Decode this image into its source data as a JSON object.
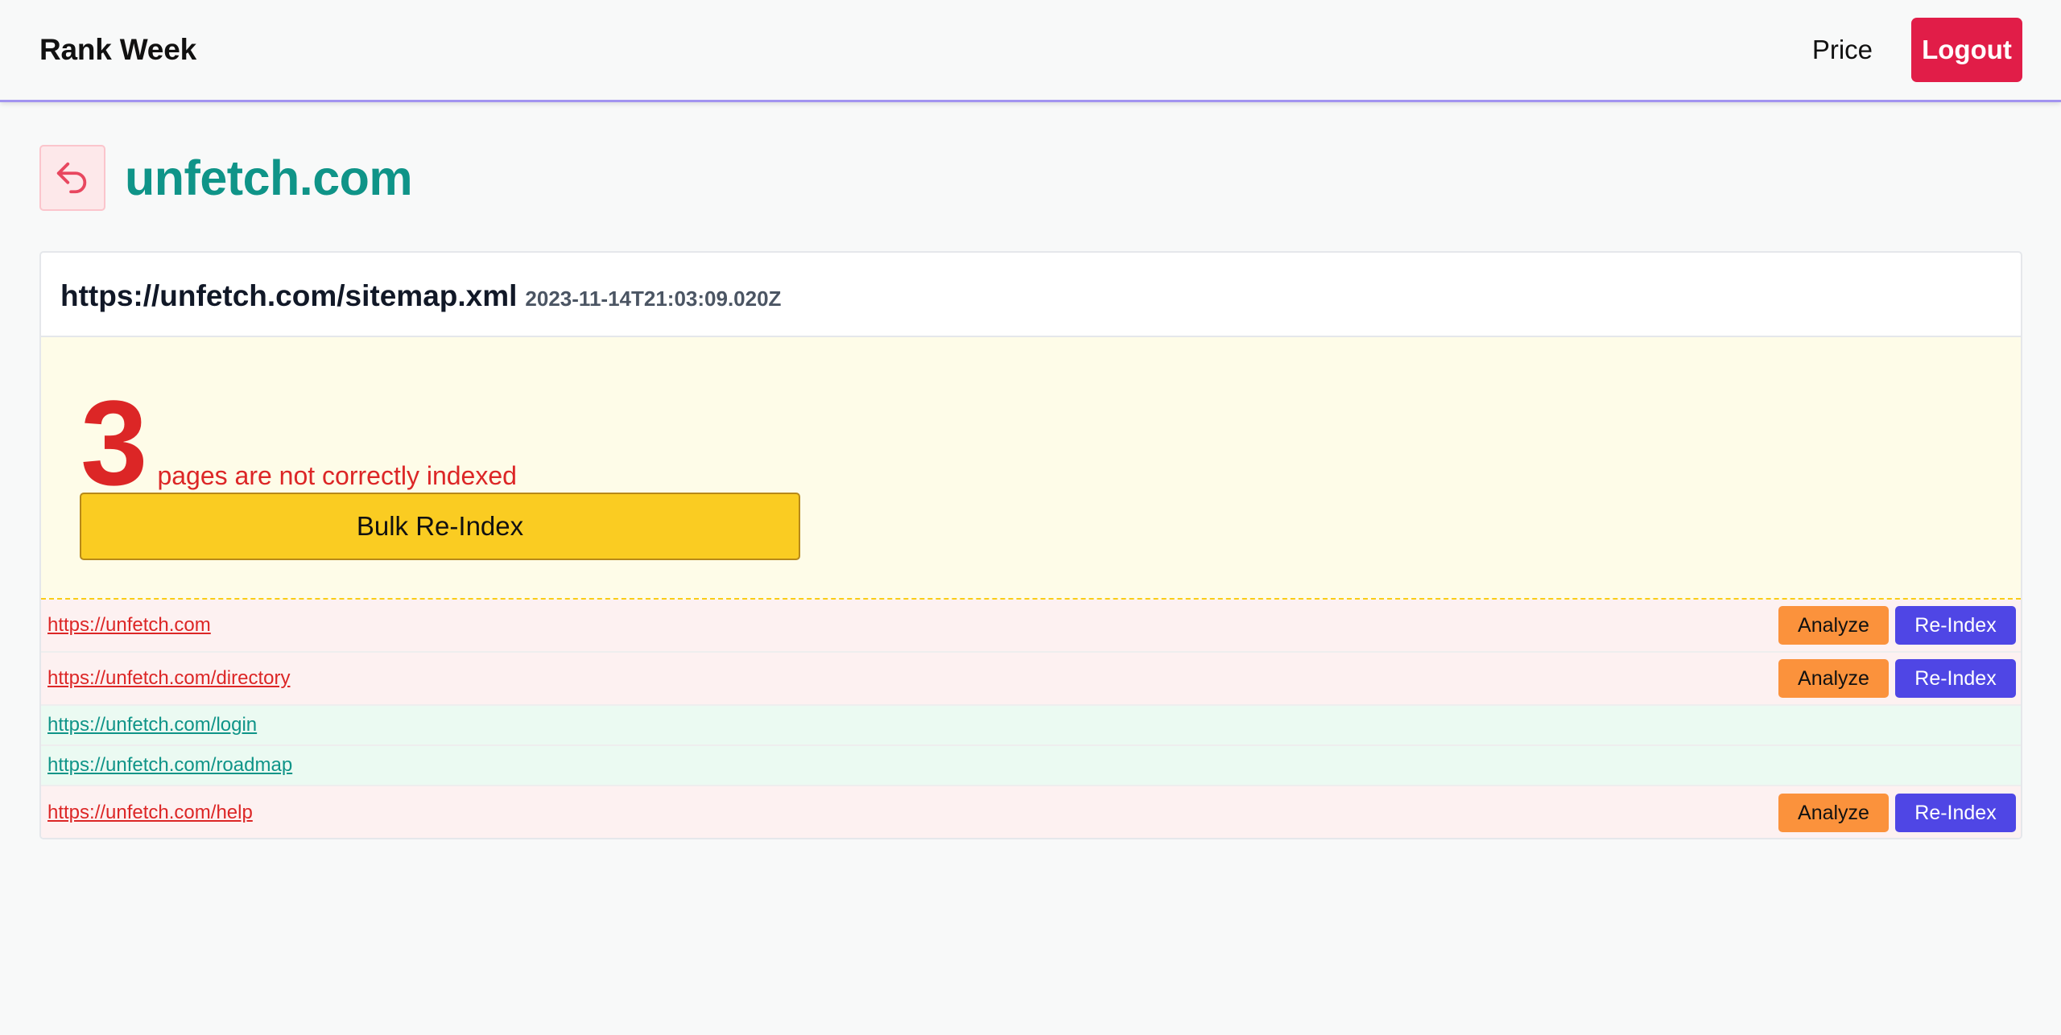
{
  "nav": {
    "brand": "Rank Week",
    "price_label": "Price",
    "logout_label": "Logout"
  },
  "page": {
    "site_title": "unfetch.com"
  },
  "sitemap": {
    "url": "https://unfetch.com/sitemap.xml",
    "fetched_at": "2023-11-14T21:03:09.020Z",
    "not_indexed_count": "3",
    "not_indexed_text": "pages are not correctly indexed",
    "bulk_reindex_label": "Bulk Re-Index"
  },
  "urls": [
    {
      "url": "https://unfetch.com",
      "status": "not-indexed",
      "analyze_label": "Analyze",
      "reindex_label": "Re-Index"
    },
    {
      "url": "https://unfetch.com/directory",
      "status": "not-indexed",
      "analyze_label": "Analyze",
      "reindex_label": "Re-Index"
    },
    {
      "url": "https://unfetch.com/login",
      "status": "indexed"
    },
    {
      "url": "https://unfetch.com/roadmap",
      "status": "indexed"
    },
    {
      "url": "https://unfetch.com/help",
      "status": "not-indexed",
      "analyze_label": "Analyze",
      "reindex_label": "Re-Index"
    }
  ],
  "colors": {
    "accent": "#0f9488",
    "danger": "#e11d48",
    "warning": "#facc22",
    "analyze": "#fb923c",
    "reindex": "#4f46e5",
    "nav_border": "#a294f0"
  },
  "icons": {
    "back": "undo-arrow-icon"
  }
}
